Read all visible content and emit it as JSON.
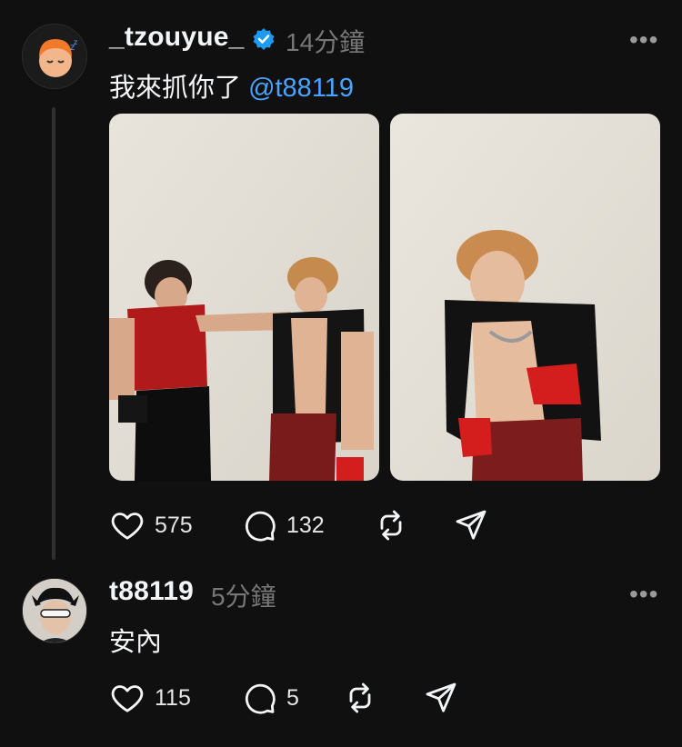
{
  "post": {
    "username": "_tzouyue_",
    "time": "14分鐘",
    "text": "我來抓你了 ",
    "mention": "@t88119",
    "more": "•••",
    "likes": "575",
    "comments": "132"
  },
  "reply": {
    "username": "t88119",
    "time": "5分鐘",
    "text": "安內",
    "more": "•••",
    "likes": "115",
    "comments": "5"
  },
  "colors": {
    "background": "#101010",
    "mention": "#4aa3ff",
    "verified": "#1d9bf0",
    "muted": "#777777"
  },
  "icons": [
    "heart-icon",
    "comment-icon",
    "repost-icon",
    "share-icon",
    "verified-badge-icon",
    "more-icon"
  ]
}
